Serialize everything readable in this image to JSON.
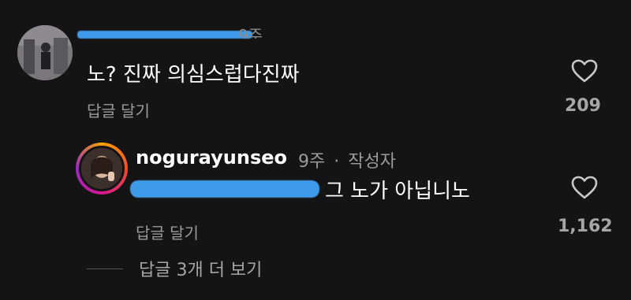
{
  "comment1": {
    "time": "9주",
    "text": "노? 진짜 의심스럽다진짜",
    "reply_label": "답글 달기",
    "likes": "209"
  },
  "comment2": {
    "username": "nogurayunseo",
    "time": "9주",
    "separator": "·",
    "author_badge": "작성자",
    "text": "그 노가 아닙니노",
    "reply_label": "답글 달기",
    "likes": "1,162"
  },
  "more_replies": "답글 3개 더 보기",
  "icons": {
    "heart": "heart-outline-icon"
  },
  "colors": {
    "background": "#141414",
    "redaction": "#3f9bea"
  }
}
